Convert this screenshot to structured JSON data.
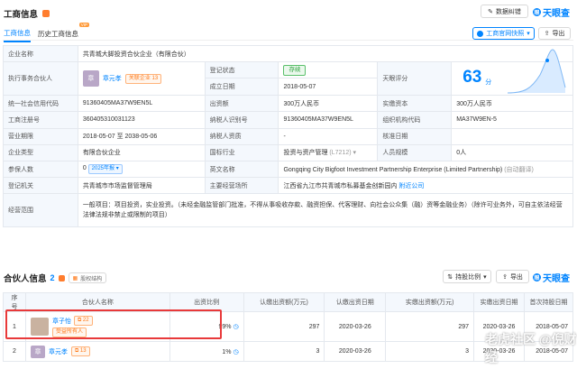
{
  "header": {
    "title": "工商信息",
    "title_badge": "●",
    "report_error": "数据纠错",
    "logo": "天眼查",
    "tabs": [
      {
        "label": "工商信息"
      },
      {
        "label": "历史工商信息",
        "badge": "VIP"
      }
    ],
    "snapshot_btn": "工商官网快照",
    "export_btn": "导出"
  },
  "info": {
    "company_name_label": "企业名称",
    "company_name": "共青城大脚投资合伙企业（有限合伙）",
    "partner_label": "执行事务合伙人",
    "partner_avatar": "章",
    "partner_name": "章元孝",
    "partner_tag": "关联企业 13",
    "status_label": "登记状态",
    "status": "存续",
    "est_label": "成立日期",
    "est_date": "2018-05-07",
    "score_label": "天眼评分",
    "score": "63",
    "score_unit": "分",
    "credit_label": "统一社会信用代码",
    "credit_code": "91360405MA37W9EN5L",
    "capital_label": "出资额",
    "capital": "300万人民币",
    "paid_label": "实缴资本",
    "paid": "300万人民币",
    "regno_label": "工商注册号",
    "regno": "360405310031123",
    "taxno_label": "纳税人识别号",
    "taxno": "91360405MA37W9EN5L",
    "orgcode_label": "组织机构代码",
    "orgcode": "MA37W9EN-5",
    "term_label": "营业期限",
    "term": "2018-05-07 至 2038-05-06",
    "taxq_label": "纳税人资质",
    "taxq": "-",
    "approve_label": "核准日期",
    "approve": "",
    "type_label": "企业类型",
    "type": "有限合伙企业",
    "industry_label": "国标行业",
    "industry": "投资与资产管理",
    "industry_code": "(L7212)",
    "staff_label": "人员规模",
    "staff": "0人",
    "insured_label": "参保人数",
    "insured": "0",
    "insured_tag": "2025年报",
    "en_label": "英文名称",
    "en_name": "Gongqing City Bigfoot Investment Partnership Enterprise (Limited Partnership)",
    "en_auto": "(自动翻译)",
    "authority_label": "登记机关",
    "authority": "共青城市市场监督管理局",
    "address_label": "主要经营场所",
    "address": "江西省九江市共青城市私募基金创新园内",
    "address_link": "附近公司",
    "scope_label": "经营范围",
    "scope": "一般项目：项目投资，实业投资。（未经金融监管部门批准，不得从事吸收存款、融资担保、代客理财、向社会公众集（融）资等金融业务）（除许可业务外，可自主依法经营法律法规非禁止或限制的项目）"
  },
  "partners_section": {
    "title": "合伙人信息",
    "count": "2",
    "equity_btn": "股权结构",
    "ratio_btn": "持股比例",
    "export_btn": "导出",
    "logo": "天眼查",
    "columns": [
      "序号",
      "合伙人名称",
      "出资比例",
      "认缴出资额(万元)",
      "认缴出资日期",
      "实缴出资额(万元)",
      "实缴出资日期",
      "首次持股日期"
    ],
    "rows": [
      {
        "idx": "1",
        "name": "章子怡",
        "tag": "22",
        "role": "受益所有人",
        "ratio": "99%",
        "sub_amt": "297",
        "sub_date": "2020-03-26",
        "paid_amt": "297",
        "paid_date": "2020-03-26",
        "first_date": "2018-05-07"
      },
      {
        "idx": "2",
        "name": "章元孝",
        "avatar": "章",
        "tag": "13",
        "ratio": "1%",
        "sub_amt": "3",
        "sub_date": "2020-03-26",
        "paid_amt": "3",
        "paid_date": "2020-03-26",
        "first_date": "2018-05-07"
      }
    ]
  },
  "watermark": "老虎社区 @倪财经",
  "colors": {
    "accent": "#0084ff",
    "highlight": "#e8393a",
    "status": "#2ea33f"
  }
}
